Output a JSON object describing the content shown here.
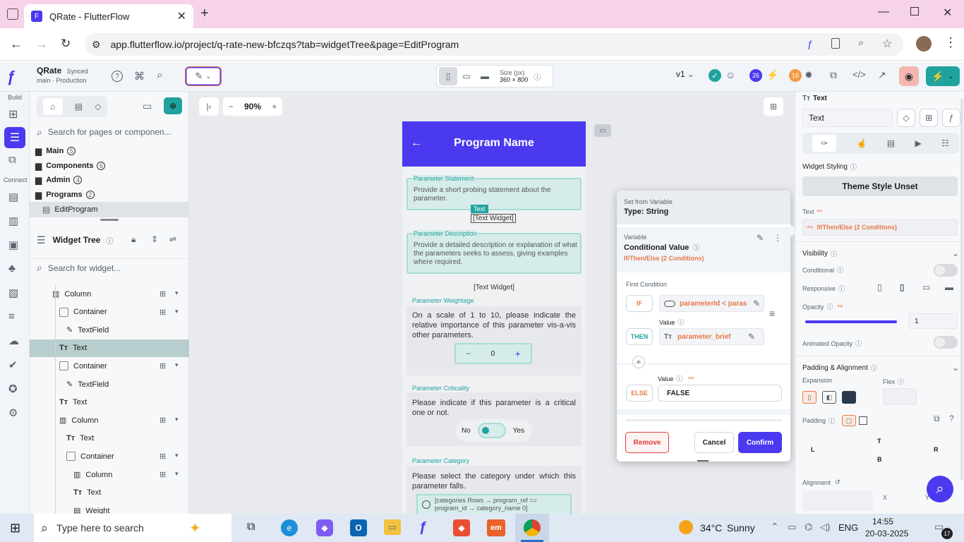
{
  "browser": {
    "tab_title": "QRate - FlutterFlow",
    "url": "app.flutterflow.io/project/q-rate-new-bfczqs?tab=widgetTree&page=EditProgram"
  },
  "topbar": {
    "project_name": "QRate",
    "sync_status": "Synced",
    "branch": "main",
    "environment": "Production",
    "size_label": "Size (px)",
    "size_value": "360 × 800",
    "version": "v1",
    "badge_count_1": "26",
    "badge_count_2": "16"
  },
  "rail": {
    "build_label": "Build",
    "connect_label": "Connect"
  },
  "left_panel": {
    "search_placeholder": "Search for pages or componen...",
    "folders": [
      {
        "label": "Main",
        "count": "5"
      },
      {
        "label": "Components",
        "count": "6"
      },
      {
        "label": "Admin",
        "count": "4"
      },
      {
        "label": "Programs",
        "count": "2"
      }
    ],
    "selected_page": "EditProgram",
    "widget_tree_title": "Widget Tree",
    "widget_search_placeholder": "Search for widget...",
    "tree_items": [
      {
        "label": "Column",
        "indent": 1,
        "icon": "column"
      },
      {
        "label": "Container",
        "indent": 2,
        "icon": "container"
      },
      {
        "label": "TextField",
        "indent": 3,
        "icon": "textfield"
      },
      {
        "label": "Text",
        "indent": 2,
        "icon": "text",
        "selected": true
      },
      {
        "label": "Container",
        "indent": 2,
        "icon": "container"
      },
      {
        "label": "TextField",
        "indent": 3,
        "icon": "textfield"
      },
      {
        "label": "Text",
        "indent": 2,
        "icon": "text"
      },
      {
        "label": "Column",
        "indent": 2,
        "icon": "column"
      },
      {
        "label": "Text",
        "indent": 3,
        "icon": "text"
      },
      {
        "label": "Container",
        "indent": 3,
        "icon": "container"
      },
      {
        "label": "Column",
        "indent": 4,
        "icon": "column"
      },
      {
        "label": "Text",
        "indent": 4,
        "icon": "text"
      },
      {
        "label": "Weight",
        "indent": 4,
        "icon": "widget"
      }
    ]
  },
  "canvas": {
    "zoom": "90%",
    "phone": {
      "appbar_title": "Program Name",
      "param_statement_label": "Parameter Statement",
      "param_statement_hint": "Provide a short probing statement about the parameter.",
      "selected_tag": "Text",
      "selected_text": "[Text Widget]",
      "param_description_label": "Parameter Description",
      "param_description_hint": "Provide a detailed description or explanation of what the parameters seeks to assess, giving examples where required.",
      "text_widget_2": "[Text Widget]",
      "weightage_label": "Parameter Weightage",
      "weightage_text": "On a scale of 1 to 10, please indicate the relative importance of this parameter vis-a-vis other parameters.",
      "stepper_minus": "−",
      "stepper_value": "0",
      "stepper_plus": "+",
      "criticality_label": "Parameter Criticality",
      "criticality_text": "Please indicate if this parameter is a critical one or not.",
      "toggle_no": "No",
      "toggle_yes": "Yes",
      "category_label": "Parameter Category",
      "category_text": "Please select the category under which this parameter falls.",
      "category_option": "[categories Rows → program_ref == program_id → category_name 0]"
    }
  },
  "dialog": {
    "header_title": "Set from Variable",
    "header_type": "Type: String",
    "variable_label": "Variable",
    "variable_value": "Conditional Value",
    "variable_sub": "If/Then/Else (2 Conditions)",
    "first_condition": "First Condition",
    "if_label": "IF",
    "if_value": "parameterId < paras",
    "value_label": "Value",
    "then_label": "THEN",
    "then_value": "parameter_brief",
    "else_value_label": "Value",
    "else_label": "ELSE",
    "else_value": "FALSE",
    "remove_label": "Remove",
    "cancel_label": "Cancel",
    "confirm_label": "Confirm"
  },
  "right_panel": {
    "widget_type": "Text",
    "widget_name": "Text",
    "widget_styling": "Widget Styling",
    "theme_style": "Theme Style Unset",
    "text_label": "Text",
    "text_value": "If/Then/Else (2 Conditions)",
    "visibility": "Visibility",
    "conditional": "Conditional",
    "responsive": "Responsive",
    "opacity": "Opacity",
    "opacity_value": "1",
    "opacity_level": 1,
    "animated_opacity": "Animated Opacity",
    "padding_alignment": "Padding & Alignment",
    "expansion": "Expansion",
    "flex": "Flex",
    "padding": "Padding",
    "pad_t": "T",
    "pad_l": "L",
    "pad_r": "R",
    "pad_b": "B",
    "alignment": "Alignment",
    "align_x": "X",
    "align_y": "Y"
  },
  "taskbar": {
    "search_placeholder": "Type here to search",
    "weather_temp": "34°C",
    "weather_text": "Sunny",
    "language": "ENG",
    "time": "14:55",
    "date": "20-03-2025",
    "notif_count": "17"
  },
  "colors": {
    "primary": "#4b39ef",
    "appbar": "#4b39ef",
    "teal": "#20a39e",
    "orange": "#e8784a",
    "danger": "#e04040"
  }
}
